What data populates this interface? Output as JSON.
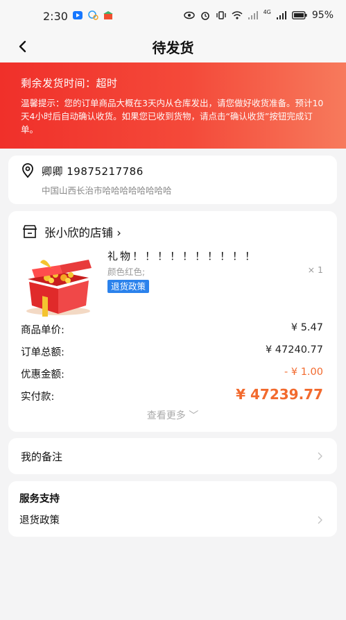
{
  "status_bar": {
    "time": "2:30",
    "battery": "95%",
    "network_label": "4G"
  },
  "nav": {
    "title": "待发货"
  },
  "banner": {
    "remaining_label": "剩余发货时间：超时",
    "tip": "温馨提示：您的订单商品大概在3天内从仓库发出，请您做好收货准备。预计10天4小时后自动确认收货。如果您已收到货物，请点击“确认收货”按钮完成订单。"
  },
  "address": {
    "name_phone": "卿卿 19875217786",
    "line": "中国山西长治市哈哈哈哈哈哈哈哈"
  },
  "shop": {
    "name": "张小欣的店铺 ›",
    "product": {
      "title": "礼物！！！！！！！！！！",
      "spec": "颜色红色;",
      "qty": "× 1",
      "policy_tag": "退货政策"
    },
    "rows": [
      {
        "label": "商品单价:",
        "value": "¥ 5.47"
      },
      {
        "label": "订单总额:",
        "value": "¥ 47240.77"
      },
      {
        "label": "优惠金额:",
        "value": "- ¥ 1.00"
      },
      {
        "label": "实付款:",
        "value": "¥ 47239.77"
      }
    ],
    "more": "查看更多 ﹀"
  },
  "note": {
    "label": "我的备注"
  },
  "support": {
    "heading": "服务支持",
    "item": "退货政策"
  },
  "colors": {
    "banner_start": "#f0302a",
    "banner_end": "#f77a5c",
    "accent_orange": "#f26a2e",
    "tag_blue": "#2b82ec"
  }
}
